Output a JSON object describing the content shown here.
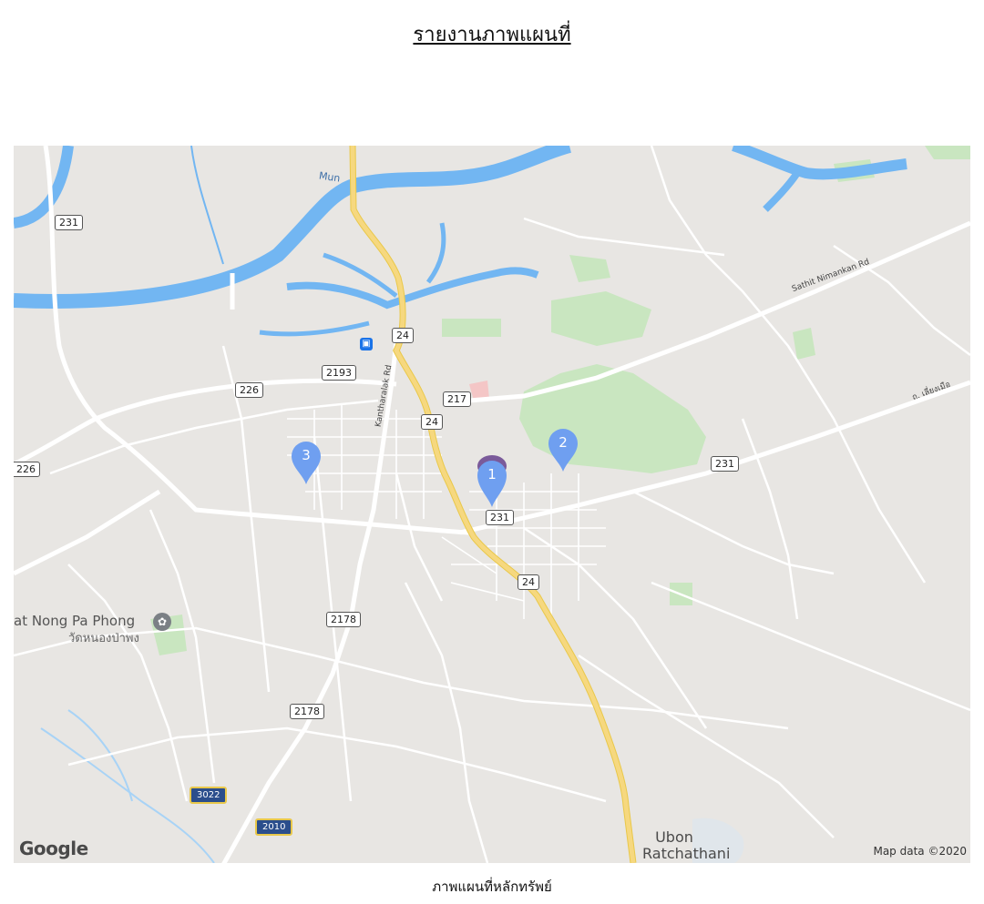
{
  "report": {
    "title": "รายงานภาพแผนที่"
  },
  "map": {
    "caption": "ภาพแผนที่หลักทรัพย์",
    "attribution": "Map data ©2020",
    "logo_text": "Google",
    "river_label": "Mun",
    "city": {
      "line1": "Ubon",
      "line2": "Ratchathani"
    },
    "poi": {
      "name_en": "at Nong Pa Phong",
      "name_th": "วัดหนองป่าพง",
      "icon": "temple-icon"
    },
    "road_labels": {
      "sathit": "Sathit Nimankan Rd",
      "kantharalak": "Kantharalak Rd",
      "thai_road": "ถ. เลี่ยงเมือ"
    },
    "shields": [
      {
        "id": "s231a",
        "label": "231"
      },
      {
        "id": "s24a",
        "label": "24"
      },
      {
        "id": "s2193",
        "label": "2193"
      },
      {
        "id": "s226a",
        "label": "226"
      },
      {
        "id": "s217",
        "label": "217"
      },
      {
        "id": "s24b",
        "label": "24"
      },
      {
        "id": "s226b",
        "label": "226"
      },
      {
        "id": "s231b",
        "label": "231"
      },
      {
        "id": "s231c",
        "label": "231"
      },
      {
        "id": "s24c",
        "label": "24"
      },
      {
        "id": "s2178a",
        "label": "2178"
      },
      {
        "id": "s2178b",
        "label": "2178"
      },
      {
        "id": "s3022",
        "label": "3022"
      },
      {
        "id": "s2010",
        "label": "2010"
      }
    ],
    "markers": [
      {
        "label": "1",
        "color": "#6f9ff0"
      },
      {
        "label": "2",
        "color": "#6f9ff0"
      },
      {
        "label": "3",
        "color": "#6f9ff0"
      }
    ],
    "colors": {
      "land": "#e8e6e3",
      "water": "#72b6f2",
      "park": "#c9e6c0",
      "highway": "#f6d87f",
      "road": "#ffffff"
    }
  }
}
